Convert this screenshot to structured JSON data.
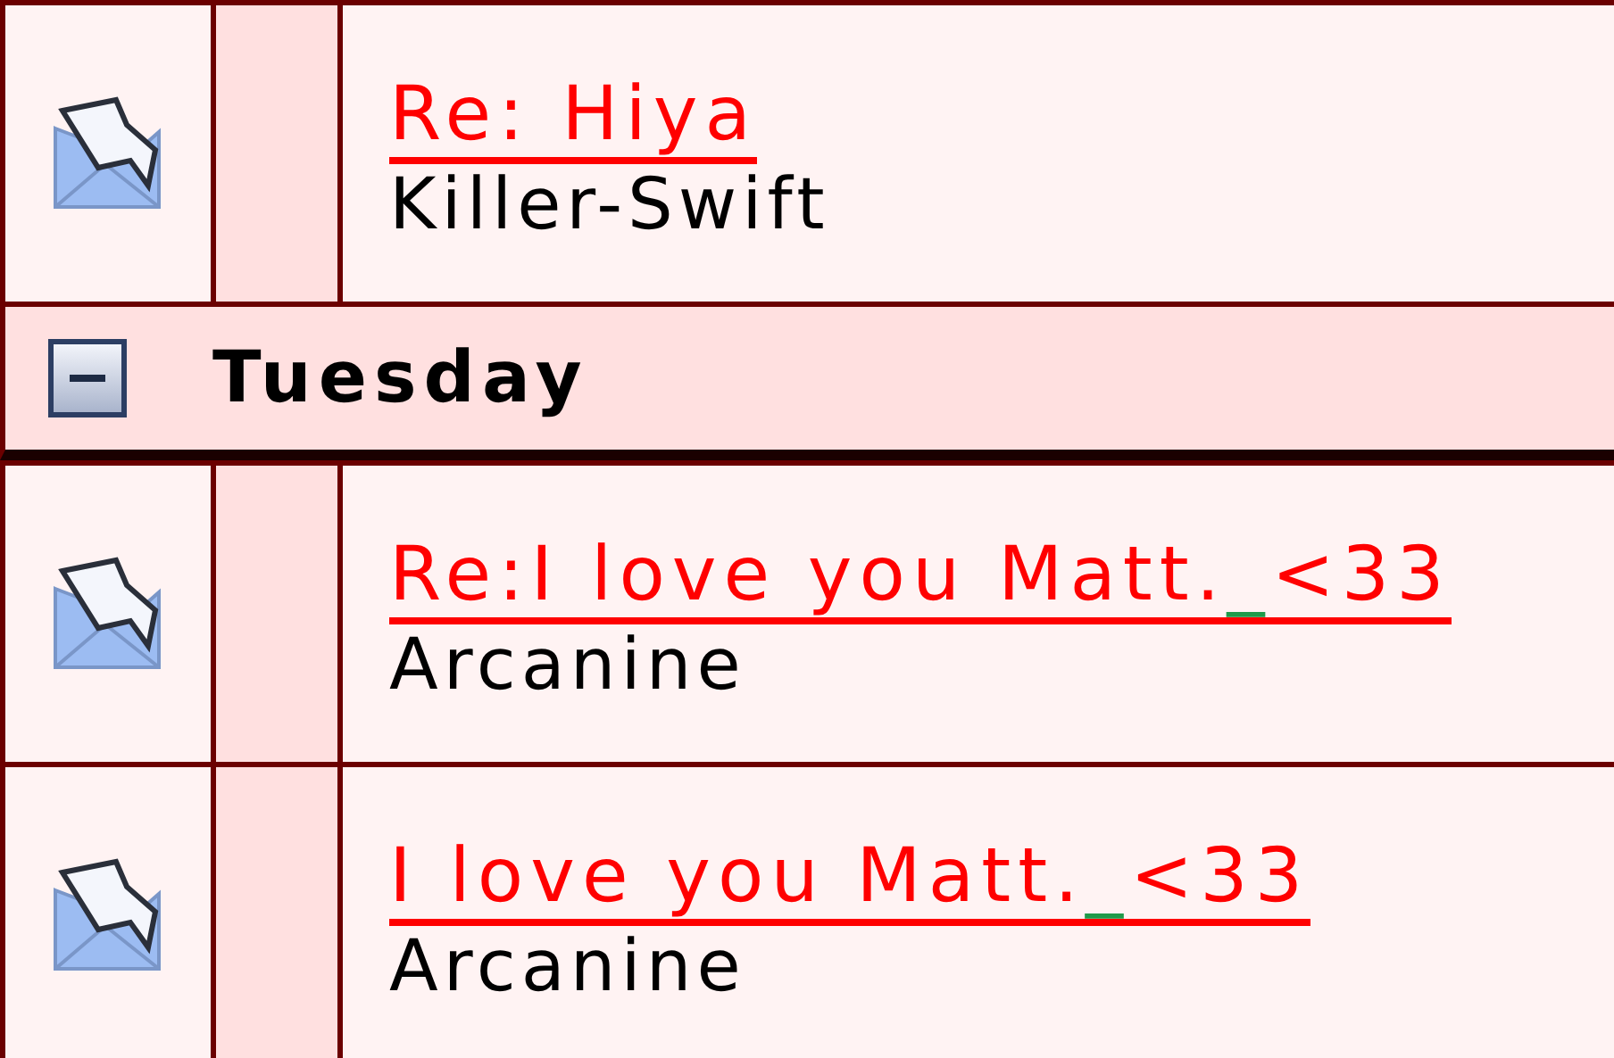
{
  "messages_before": [
    {
      "subject": [
        {
          "text": "Re: Hiya"
        }
      ],
      "sender": "Killer-Swift"
    }
  ],
  "group": {
    "label": "Tuesday",
    "expanded": true,
    "messages": [
      {
        "subject": [
          {
            "text": "Re:I love you Matt."
          },
          {
            "text": "_",
            "color": "#1f9a4a"
          },
          {
            "text": "<33"
          }
        ],
        "sender": "Arcanine"
      },
      {
        "subject": [
          {
            "text": "I love you Matt."
          },
          {
            "text": "_",
            "color": "#1f9a4a"
          },
          {
            "text": "<33"
          }
        ],
        "sender": "Arcanine"
      }
    ]
  }
}
